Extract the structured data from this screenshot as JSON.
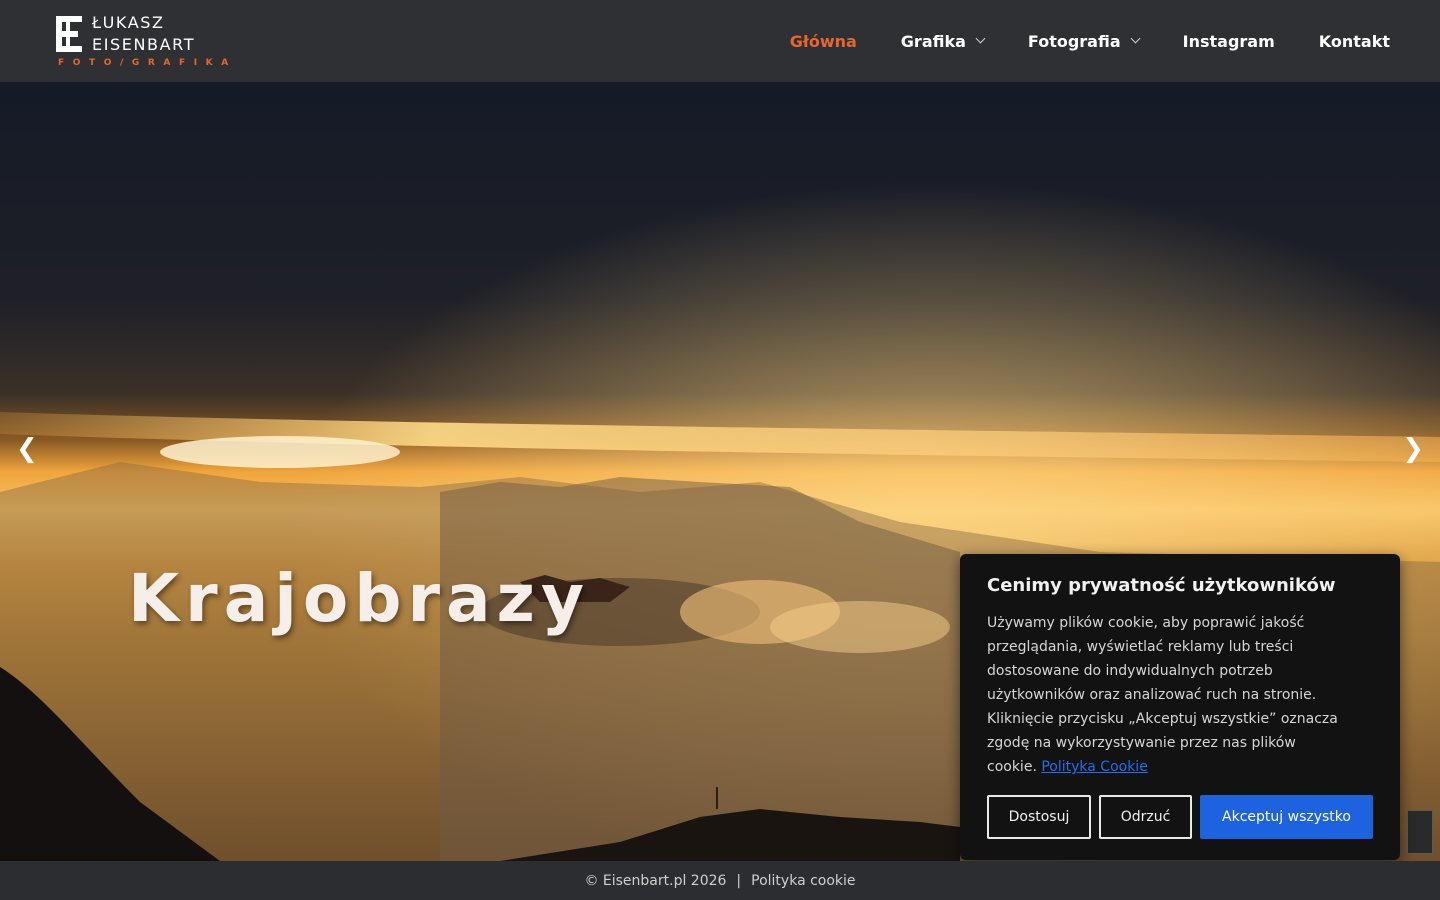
{
  "brand": {
    "name_line1": "ŁUKASZ",
    "name_line2": "EISENBART",
    "tagline": "FOTO/GRAFIKA",
    "accent_color": "#e9652b"
  },
  "nav": {
    "items": [
      {
        "label": "Główna",
        "active": true,
        "has_dropdown": false
      },
      {
        "label": "Grafika",
        "active": false,
        "has_dropdown": true
      },
      {
        "label": "Fotografia",
        "active": false,
        "has_dropdown": true
      },
      {
        "label": "Instagram",
        "active": false,
        "has_dropdown": false
      },
      {
        "label": "Kontakt",
        "active": false,
        "has_dropdown": false
      }
    ]
  },
  "hero": {
    "slide_title": "Krajobrazy",
    "prev_arrow": "❮",
    "next_arrow": "❯"
  },
  "cookie": {
    "title": "Cenimy prywatność użytkowników",
    "text": "Używamy plików cookie, aby poprawić jakość przeglądania, wyświetlać reklamy lub treści dostosowane do indywidualnych potrzeb użytkowników oraz analizować ruch na stronie. Kliknięcie przycisku „Akceptuj wszystkie” oznacza zgodę na wykorzystywanie przez nas plików cookie.",
    "policy_link": "Polityka Cookie",
    "buttons": {
      "customize": "Dostosuj",
      "reject": "Odrzuć",
      "accept_all": "Akceptuj wszystko"
    },
    "accept_color": "#1d63e0"
  },
  "footer": {
    "copyright": "© Eisenbart.pl 2026",
    "separator": "|",
    "cookie_link": "Polityka cookie"
  }
}
